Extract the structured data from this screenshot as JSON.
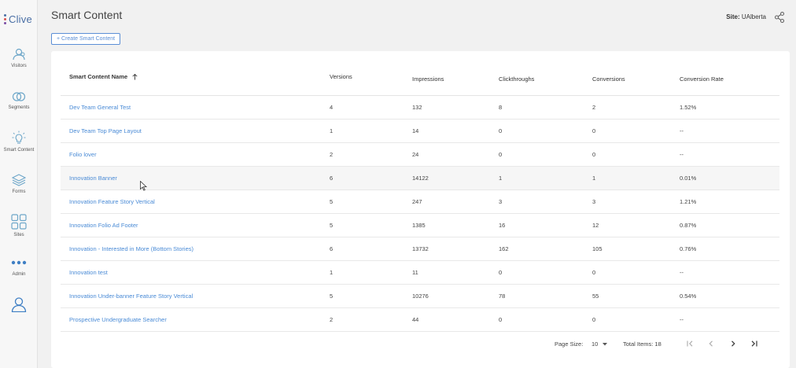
{
  "app": {
    "name": "Clive",
    "logo_dot_colors": [
      "#4a6fa5",
      "#d9534f",
      "#7b4ea5"
    ]
  },
  "sidebar": {
    "items": [
      {
        "label": "Visitors",
        "icon": "visitors-icon"
      },
      {
        "label": "Segments",
        "icon": "segments-icon"
      },
      {
        "label": "Smart Content",
        "icon": "smart-content-icon"
      },
      {
        "label": "Forms",
        "icon": "forms-icon"
      },
      {
        "label": "Sites",
        "icon": "sites-icon"
      },
      {
        "label": "Admin",
        "icon": "more-dots-icon"
      },
      {
        "label": "",
        "icon": "user-icon"
      }
    ]
  },
  "header": {
    "title": "Smart Content",
    "create_button": "+ Create Smart Content",
    "site_label": "Site:",
    "site_value": "UAlberta",
    "share_icon": "share-icon"
  },
  "table": {
    "columns": [
      "Smart Content Name",
      "Versions",
      "Impressions",
      "Clickthroughs",
      "Conversions",
      "Conversion Rate"
    ],
    "sort_column": "Smart Content Name",
    "sort_direction": "ascending",
    "rows": [
      [
        "Dev Team General Test",
        "4",
        "132",
        "8",
        "2",
        "1.52%"
      ],
      [
        "Dev Team Top Page Layout",
        "1",
        "14",
        "0",
        "0",
        "--"
      ],
      [
        "Folio lover",
        "2",
        "24",
        "0",
        "0",
        "--"
      ],
      [
        "Innovation Banner",
        "6",
        "14122",
        "1",
        "1",
        "0.01%"
      ],
      [
        "Innovation Feature Story Vertical",
        "5",
        "247",
        "3",
        "3",
        "1.21%"
      ],
      [
        "Innovation Folio Ad Footer",
        "5",
        "1385",
        "16",
        "12",
        "0.87%"
      ],
      [
        "Innovation - Interested in More (Bottom Stories)",
        "6",
        "13732",
        "162",
        "105",
        "0.76%"
      ],
      [
        "Innovation test",
        "1",
        "11",
        "0",
        "0",
        "--"
      ],
      [
        "Innovation Under-banner Feature Story Vertical",
        "5",
        "10276",
        "78",
        "55",
        "0.54%"
      ],
      [
        "Prospective Undergraduate Searcher",
        "2",
        "44",
        "0",
        "0",
        "--"
      ]
    ],
    "highlighted_row": 3,
    "link_color": "#4a8bd6"
  },
  "pagination": {
    "page_size_label": "Page Size:",
    "page_size_value": "10",
    "total_label": "Total Items: 18",
    "buttons": [
      "first-page-icon",
      "prev-page-icon",
      "next-page-icon",
      "last-page-icon"
    ]
  }
}
